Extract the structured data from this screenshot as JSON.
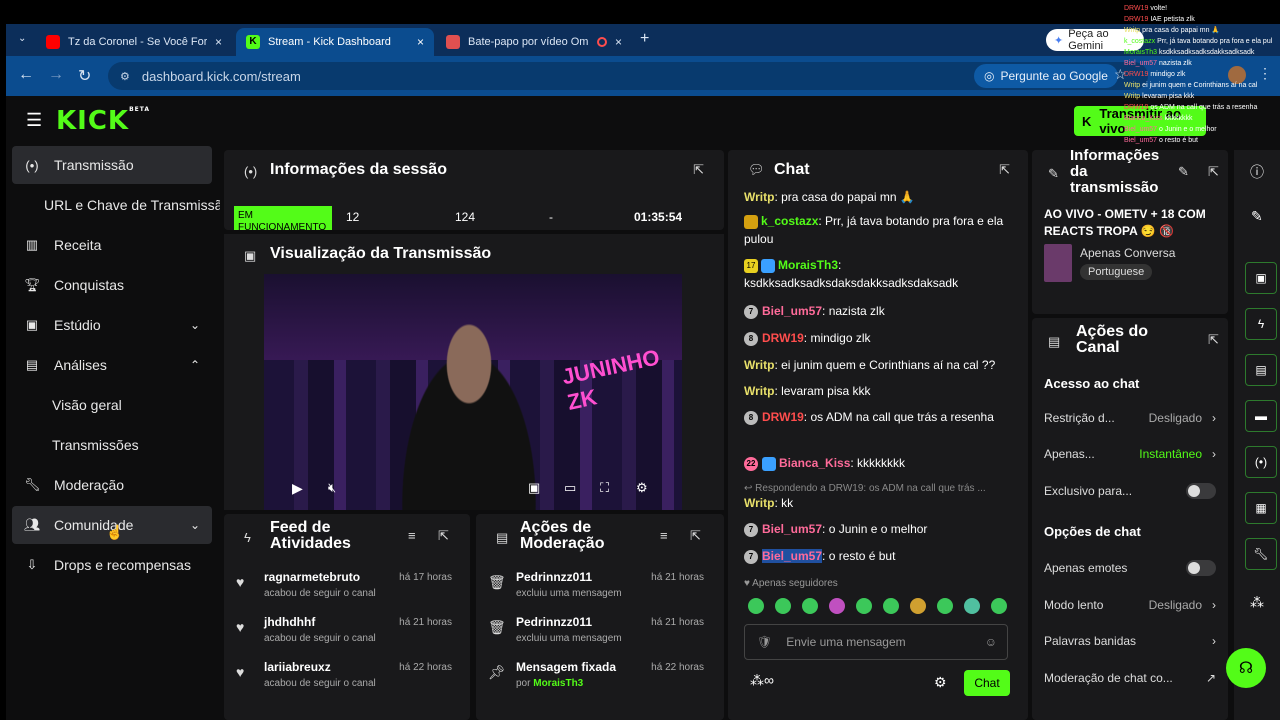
{
  "browser": {
    "tabs": [
      {
        "label": "Tz da Coronel - Se Você For Em",
        "color": "#ff0000"
      },
      {
        "label": "Stream - Kick Dashboard",
        "color": "#53fc18"
      },
      {
        "label": "Bate-papo por vídeo OmeTV",
        "color": "#e05050"
      }
    ],
    "close": "×",
    "newtab": "+",
    "url": "dashboard.kick.com/stream",
    "ask_google": "Pergunte ao Google",
    "gemini": "Peça ao Gemini"
  },
  "header": {
    "logo": "KICK",
    "beta": "BETA",
    "live_button": "Transmitir ao vivo"
  },
  "sidebar": {
    "items": [
      {
        "label": "Transmissão"
      },
      {
        "label": "URL e Chave de Transmissão"
      },
      {
        "label": "Receita"
      },
      {
        "label": "Conquistas"
      },
      {
        "label": "Estúdio"
      },
      {
        "label": "Análises"
      },
      {
        "label": "Visão geral"
      },
      {
        "label": "Transmissões"
      },
      {
        "label": "Moderação"
      },
      {
        "label": "Comunidade"
      },
      {
        "label": "Drops e recompensas"
      }
    ]
  },
  "session": {
    "title": "Informações da sessão",
    "status": "EM FUNCIONAMENTO",
    "stat1": "12",
    "stat2": "124",
    "stat3": "-",
    "duration": "01:35:54"
  },
  "preview": {
    "title": "Visualização da Transmissão",
    "overlay_text": "JUNINHO ZK"
  },
  "feed": {
    "title": "Feed de Atividades",
    "rows": [
      {
        "name": "ragnarmetebruto",
        "sub": "acabou de seguir o canal",
        "time": "há 17 horas"
      },
      {
        "name": "jhdhdhhf",
        "sub": "acabou de seguir o canal",
        "time": "há 21 horas"
      },
      {
        "name": "lariiabreuxz",
        "sub": "acabou de seguir o canal",
        "time": "há 22 horas"
      }
    ]
  },
  "modactions": {
    "title": "Ações de Moderação",
    "rows": [
      {
        "name": "Pedrinnzz011",
        "sub": "excluiu uma mensagem",
        "time": "há 21 horas"
      },
      {
        "name": "Pedrinnzz011",
        "sub": "excluiu uma mensagem",
        "time": "há 21 horas"
      },
      {
        "name": "Mensagem fixada",
        "sub": "por",
        "by": "MoraisTh3",
        "time": "há 22 horas"
      }
    ]
  },
  "chat": {
    "title": "Chat",
    "messages": [
      {
        "user": "Writp",
        "color": "#e8e06a",
        "text": "pra casa do papai mn 🙏"
      },
      {
        "user": "k_costazx",
        "color": "#53fc18",
        "text": "Prr, já tava botando pra fora e ela pulou"
      },
      {
        "user": "MoraisTh3",
        "color": "#53fc18",
        "text": "ksdkksadksadksdaksdakksadksdaksadk"
      },
      {
        "user": "Biel_um57",
        "color": "#ff6b9a",
        "text": "nazista zlk"
      },
      {
        "user": "DRW19",
        "color": "#ff4d4d",
        "text": "mindigo zlk"
      },
      {
        "user": "Writp",
        "color": "#e8e06a",
        "text": "ei junim quem e Corinthians aí na cal ??"
      },
      {
        "user": "Writp",
        "color": "#e8e06a",
        "text": "levaram pisa kkk"
      },
      {
        "user": "DRW19",
        "color": "#ff4d4d",
        "text": "os ADM na call que trás a resenha"
      },
      {
        "user": "Bianca_Kiss",
        "color": "#ff6b9a",
        "text": "kkkkkkkk"
      },
      {
        "user": "Writp",
        "color": "#e8e06a",
        "text": "kk"
      },
      {
        "user": "Biel_um57",
        "color": "#ff6b9a",
        "text": "o Junin e o melhor"
      },
      {
        "user": "Biel_um57",
        "color": "#ff6b9a",
        "text": "o resto é but"
      }
    ],
    "reply_note": "Respondendo a DRW19: os ADM na call que trás ...",
    "badges": {
      "b7": "7",
      "b8": "8",
      "b17": "17",
      "b22": "22"
    },
    "followers_only": "Apenas seguidores",
    "input_placeholder": "Envie uma mensagem",
    "send": "Chat"
  },
  "stream_info": {
    "title": "Informações da transmissão",
    "stream_title": "AO VIVO - OMETV + 18 COM REACTS TROPA 😏 🔞",
    "category": "Apenas Conversa",
    "language": "Portuguese"
  },
  "channel_actions": {
    "title": "Ações do Canal",
    "access_heading": "Acesso ao chat",
    "restriction": "Restrição d...",
    "restriction_val": "Desligado",
    "only": "Apenas...",
    "only_val": "Instantâneo",
    "exclusive": "Exclusivo para...",
    "chat_options": "Opções de chat",
    "emotes_only": "Apenas emotes",
    "slow_mode": "Modo lento",
    "slow_val": "Desligado",
    "banned_words": "Palavras banidas",
    "mod_link": "Moderação de chat co..."
  },
  "overlay_chat": [
    {
      "user": "DRW19",
      "text": "volte!"
    },
    {
      "user": "DRW19",
      "text": "IAE petista zlk"
    },
    {
      "user": "Writp",
      "text": "pra casa do papai mn 🙏"
    },
    {
      "user": "k_costazx",
      "text": "Prr, já tava botando pra fora e ela pul"
    },
    {
      "user": "MoraisTh3",
      "text": "ksdkksadksadksdakksadksadk"
    },
    {
      "user": "Biel_um57",
      "text": "nazista zlk"
    },
    {
      "user": "DRW19",
      "text": "mindigo zlk"
    },
    {
      "user": "Writp",
      "text": "ei junim quem e Corinthians aí na cal"
    },
    {
      "user": "Writp",
      "text": "levaram pisa kkk"
    },
    {
      "user": "DRW19",
      "text": "os ADM na call que trás a resenha"
    },
    {
      "user": "Bianca_Kiss",
      "text": "kkkkkkkk"
    },
    {
      "user": "Biel_um57",
      "text": "o Junin e o melhor"
    },
    {
      "user": "Biel_um57",
      "text": "o resto é but"
    }
  ],
  "colors": {
    "accent": "#53fc18",
    "panel": "#19191b",
    "bg": "#0d0d0e"
  }
}
